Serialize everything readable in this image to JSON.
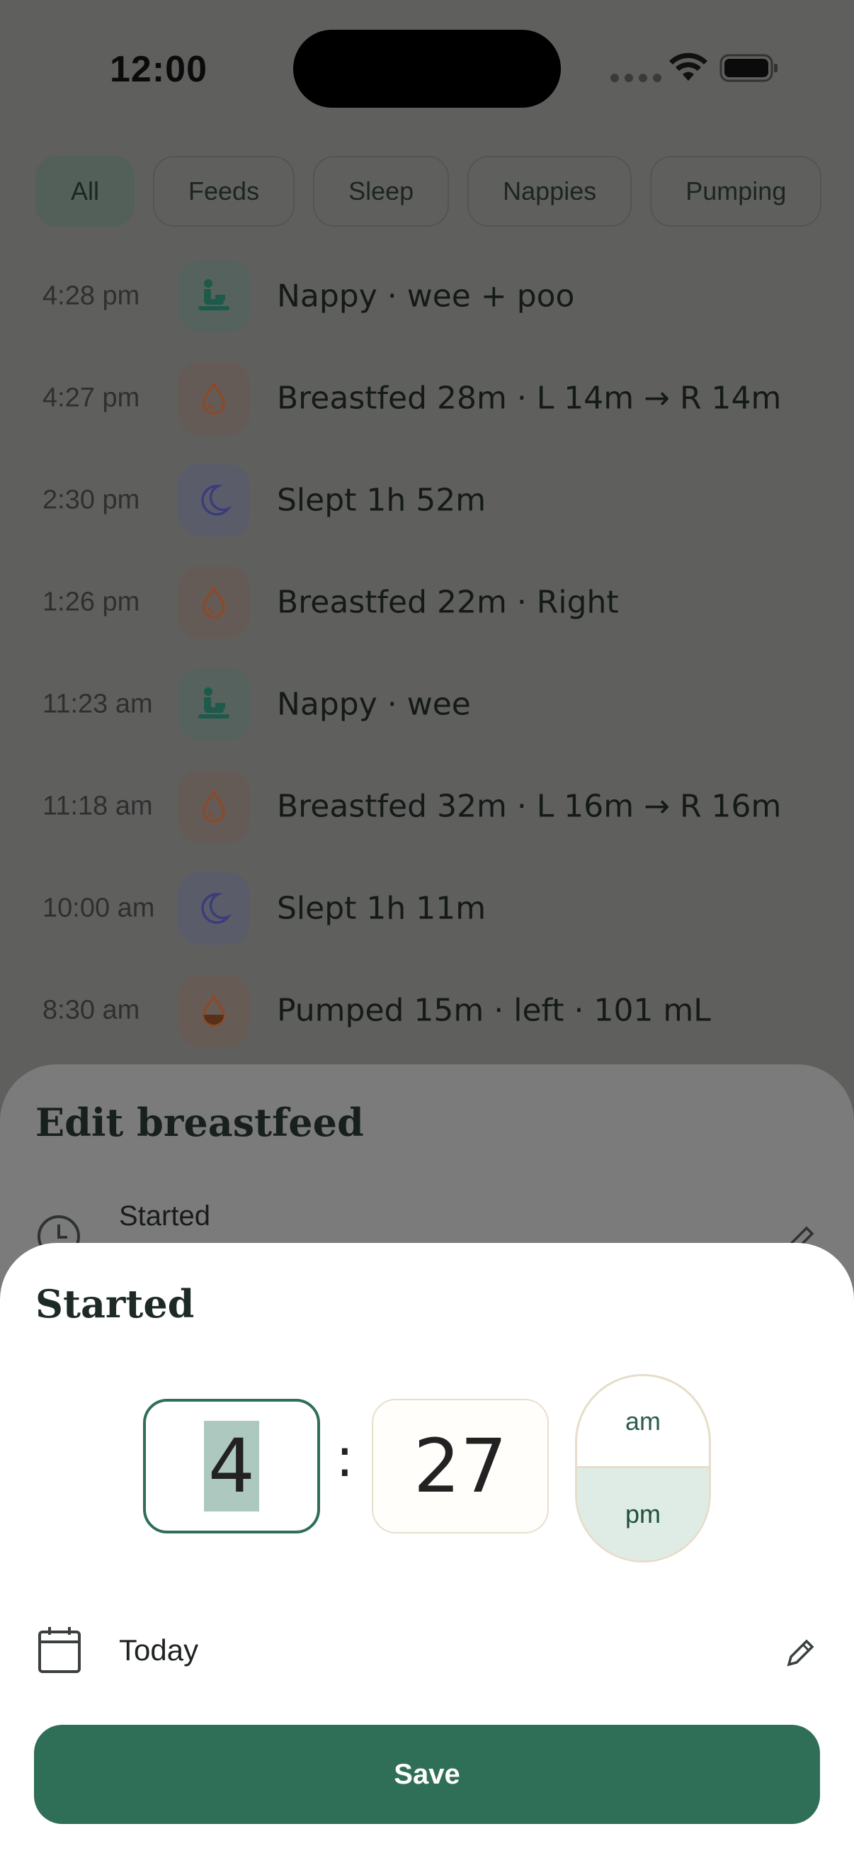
{
  "status_bar": {
    "time": "12:00"
  },
  "filters": [
    {
      "label": "All",
      "active": true
    },
    {
      "label": "Feeds",
      "active": false
    },
    {
      "label": "Sleep",
      "active": false
    },
    {
      "label": "Nappies",
      "active": false
    },
    {
      "label": "Pumping",
      "active": false
    }
  ],
  "log": [
    {
      "time": "4:28 pm",
      "icon": "nappy-icon",
      "text": "Nappy · wee + poo"
    },
    {
      "time": "4:27 pm",
      "icon": "breastfeed-drop-icon",
      "text": "Breastfed 28m · L 14m → R 14m"
    },
    {
      "time": "2:30 pm",
      "icon": "moon-icon",
      "text": "Slept 1h 52m"
    },
    {
      "time": "1:26 pm",
      "icon": "breastfeed-drop-icon",
      "text": "Breastfed 22m · Right"
    },
    {
      "time": "11:23 am",
      "icon": "nappy-icon",
      "text": "Nappy · wee"
    },
    {
      "time": "11:18 am",
      "icon": "breastfeed-drop-icon",
      "text": "Breastfed 32m · L 16m → R 16m"
    },
    {
      "time": "10:00 am",
      "icon": "moon-icon",
      "text": "Slept 1h 11m"
    },
    {
      "time": "8:30 am",
      "icon": "pump-drop-icon",
      "text": "Pumped 15m · left · 101 mL"
    }
  ],
  "edit_sheet": {
    "title": "Edit breastfeed",
    "started_label": "Started"
  },
  "time_picker": {
    "title": "Started",
    "hour": "4",
    "separator": ":",
    "minute": "27",
    "am_label": "am",
    "pm_label": "pm",
    "selected_period": "pm",
    "date_label": "Today",
    "save_label": "Save"
  },
  "colors": {
    "accent": "#2f6e57",
    "nappy": "#1e5a4a",
    "feed": "#8a4a2a",
    "sleep": "#3b3c7a"
  }
}
